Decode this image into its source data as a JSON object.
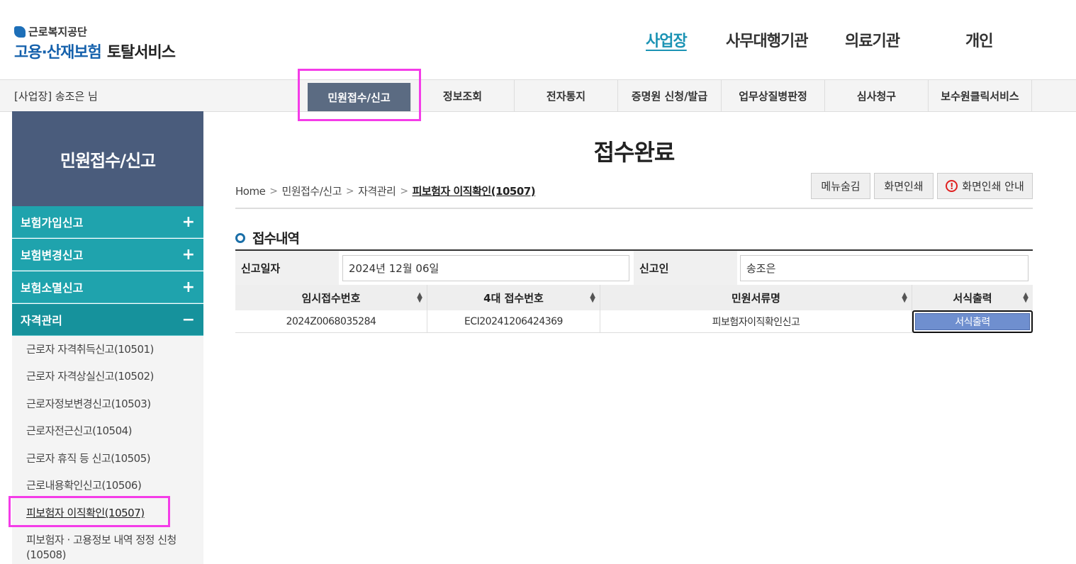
{
  "header": {
    "logo_org": "근로복지공단",
    "logo_main_blue": "고용·산재보험",
    "logo_main_dark": "토탈서비스",
    "user_types": [
      "사업장",
      "사무대행기관",
      "의료기관",
      "개인"
    ],
    "active_user_type": "사업장"
  },
  "gnb": {
    "user_info": "[사업장] 송조은 님",
    "items": [
      "민원접수/신고",
      "정보조회",
      "전자통지",
      "증명원 신청/발급",
      "업무상질병판정",
      "심사청구",
      "보수원클릭서비스"
    ],
    "active": "민원접수/신고"
  },
  "sidebar": {
    "title": "민원접수/신고",
    "menus": [
      {
        "label": "보험가입신고",
        "sign": "+"
      },
      {
        "label": "보험변경신고",
        "sign": "+"
      },
      {
        "label": "보험소멸신고",
        "sign": "+"
      },
      {
        "label": "자격관리",
        "sign": "−"
      }
    ],
    "sub_items": [
      "근로자 자격취득신고(10501)",
      "근로자 자격상실신고(10502)",
      "근로자정보변경신고(10503)",
      "근로자전근신고(10504)",
      "근로자 휴직 등 신고(10505)",
      "근로내용확인신고(10506)",
      "피보험자 이직확인(10507)",
      "피보험자 · 고용정보 내역 정정 신청",
      "(10508)"
    ]
  },
  "content": {
    "page_title": "접수완료",
    "breadcrumb": [
      "Home",
      "민원접수/신고",
      "자격관리",
      "피보험자 이직확인(10507)"
    ],
    "buttons": {
      "menu_hide": "메뉴숨김",
      "print": "화면인쇄",
      "print_guide": "화면인쇄 안내"
    },
    "section_title": "접수내역",
    "info": {
      "date_label": "신고일자",
      "date_value": "2024년 12월 06일",
      "reporter_label": "신고인",
      "reporter_value": "송조은"
    },
    "grid": {
      "headers": [
        "임시접수번호",
        "4대 접수번호",
        "민원서류명",
        "서식출력"
      ],
      "row": {
        "temp_no": "2024Z0068035284",
        "receipt_no": "ECI20241206424369",
        "doc_name": "피보험자이직확인신고",
        "print_label": "서식출력"
      }
    }
  }
}
